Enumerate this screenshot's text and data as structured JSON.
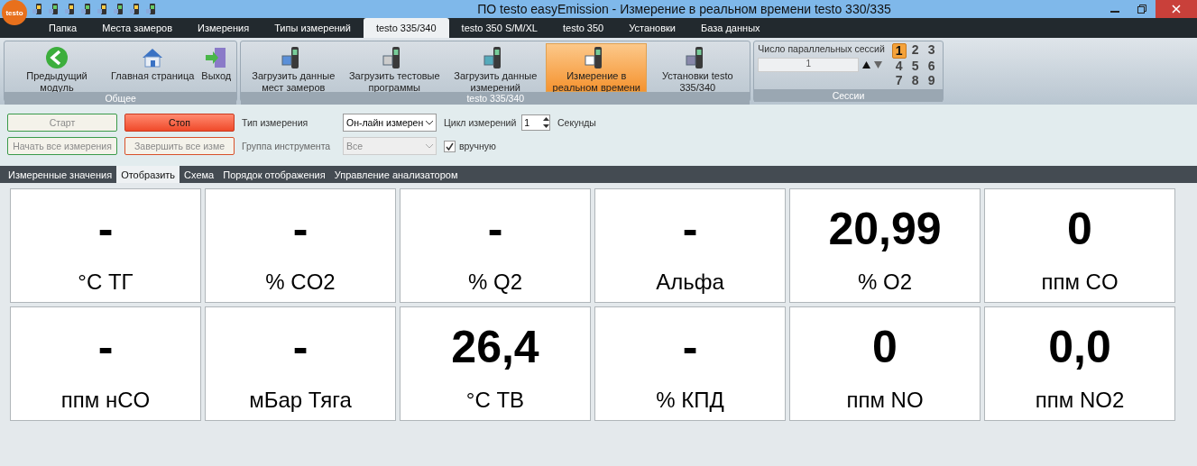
{
  "window": {
    "logo": "testo",
    "title": "ПО testo easyEmission - Измерение в реальном времени testo 330/335"
  },
  "menu_tabs": [
    {
      "label": "Папка",
      "selected": false
    },
    {
      "label": "Места замеров",
      "selected": false
    },
    {
      "label": "Измерения",
      "selected": false
    },
    {
      "label": "Типы измерений",
      "selected": false
    },
    {
      "label": "testo 335/340",
      "selected": true
    },
    {
      "label": "testo 350 S/M/XL",
      "selected": false
    },
    {
      "label": "testo 350",
      "selected": false
    },
    {
      "label": "Установки",
      "selected": false
    },
    {
      "label": "База данных",
      "selected": false
    }
  ],
  "ribbon": {
    "groups": [
      {
        "title": "Общее",
        "buttons": [
          {
            "label": "Предыдущий модуль",
            "selected": false
          },
          {
            "label": "Главная страница",
            "selected": false
          },
          {
            "label": "Выход",
            "selected": false
          }
        ]
      },
      {
        "title": "testo 335/340",
        "buttons": [
          {
            "label": "Загрузить данные мест замеров",
            "selected": false
          },
          {
            "label": "Загрузить тестовые программы",
            "selected": false
          },
          {
            "label": "Загрузить данные измерений",
            "selected": false
          },
          {
            "label": "Измерение в реальном времени",
            "selected": true
          },
          {
            "label": "Установки testo 335/340",
            "selected": false
          }
        ]
      }
    ],
    "sessions": {
      "title": "Сессии",
      "label": "Число параллельных сессий",
      "value": "1",
      "numbers": [
        {
          "label": "1",
          "selected": true
        },
        {
          "label": "2",
          "selected": false
        },
        {
          "label": "3",
          "selected": false
        },
        {
          "label": "4",
          "selected": false
        },
        {
          "label": "5",
          "selected": false
        },
        {
          "label": "6",
          "selected": false
        },
        {
          "label": "7",
          "selected": false
        },
        {
          "label": "8",
          "selected": false
        },
        {
          "label": "9",
          "selected": false
        }
      ]
    }
  },
  "controls": {
    "buttons": [
      {
        "label": "Старт",
        "kind": "green"
      },
      {
        "label": "Стоп",
        "kind": "red-fill"
      },
      {
        "label": "Начать все измерения",
        "kind": "green"
      },
      {
        "label": "Завершить все изме",
        "kind": "red"
      }
    ],
    "measure_type_label": "Тип измерения",
    "measure_type": "Он-лайн измерен",
    "group_label": "Группа инструмента",
    "group": "Все",
    "group_disabled": true,
    "cycle_label": "Цикл измерений",
    "cycle": "1",
    "cycle_unit": "Секунды",
    "manual_label": "вручную",
    "manual_checked": true
  },
  "view_tabs": [
    {
      "label": "Измеренные значения",
      "selected": false
    },
    {
      "label": "Отобразить",
      "selected": true
    },
    {
      "label": "Схема",
      "selected": false
    },
    {
      "label": "Порядок отображения",
      "selected": false
    },
    {
      "label": "Управление анализатором",
      "selected": false
    }
  ],
  "tiles": [
    {
      "value": "-",
      "unit": "°C ТГ"
    },
    {
      "value": "-",
      "unit": "% CO2"
    },
    {
      "value": "-",
      "unit": "% Q2"
    },
    {
      "value": "-",
      "unit": "Альфа"
    },
    {
      "value": "20,99",
      "unit": "% O2"
    },
    {
      "value": "0",
      "unit": "ппм CO"
    },
    {
      "value": "-",
      "unit": "ппм нCO"
    },
    {
      "value": "-",
      "unit": "мБар Тяга"
    },
    {
      "value": "26,4",
      "unit": "°C ТВ"
    },
    {
      "value": "-",
      "unit": "% КПД"
    },
    {
      "value": "0",
      "unit": "ппм NO"
    },
    {
      "value": "0,0",
      "unit": "ппм NO2"
    }
  ]
}
